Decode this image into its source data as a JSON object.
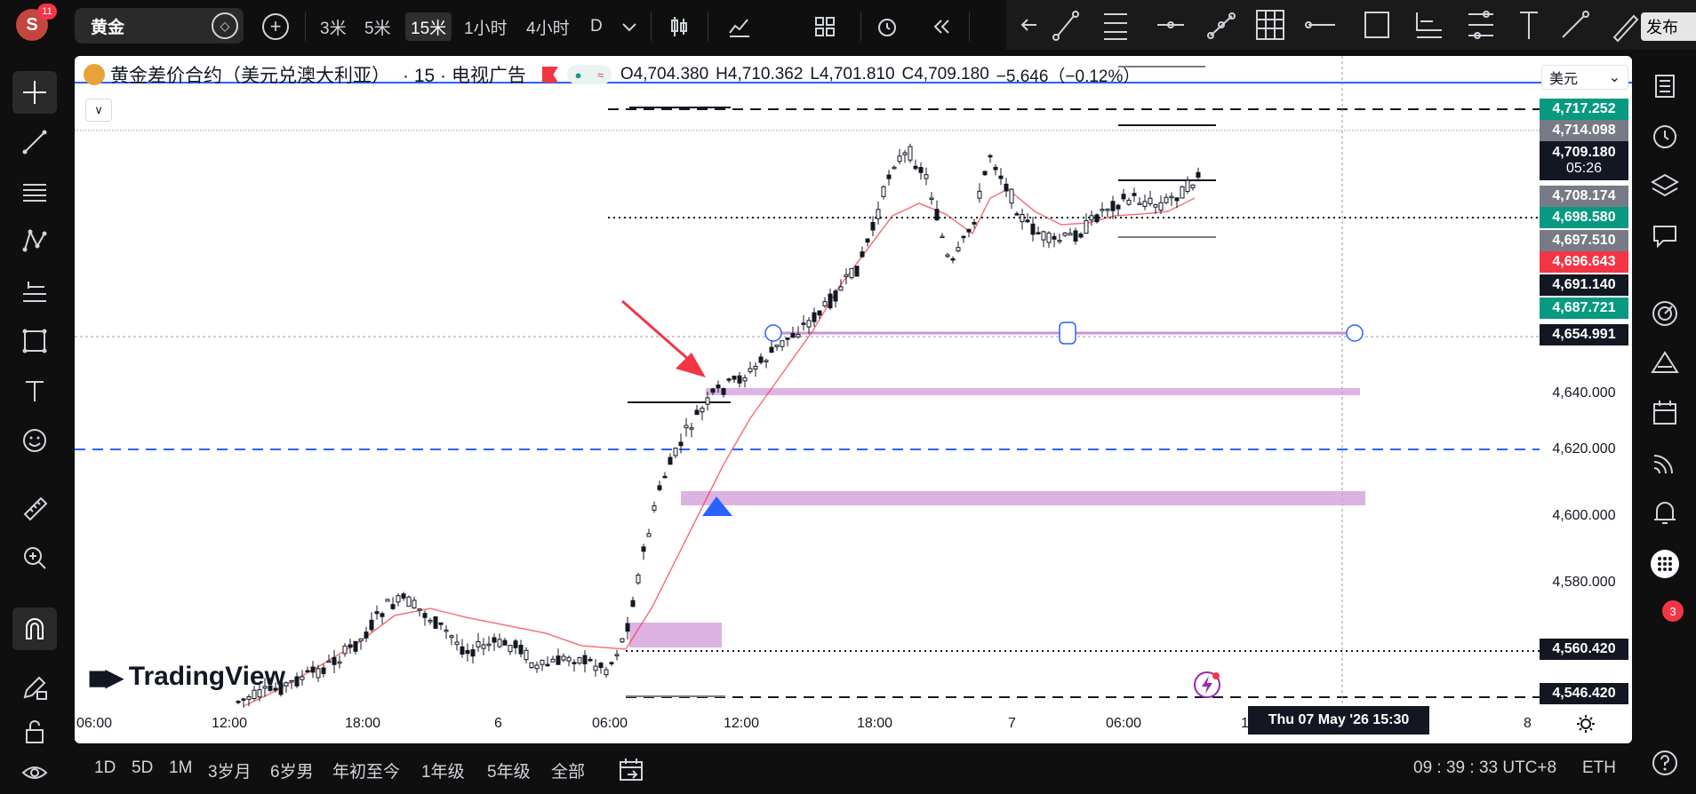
{
  "topbar": {
    "avatar_letter": "S",
    "avatar_badge": "11",
    "symbol": "黄金",
    "timeframes": [
      {
        "label": "3米",
        "active": false
      },
      {
        "label": "5米",
        "active": false
      },
      {
        "label": "15米",
        "active": true
      },
      {
        "label": "1小时",
        "active": false
      },
      {
        "label": "4小时",
        "active": false
      },
      {
        "label": "D",
        "active": false
      }
    ],
    "publish_label": "发布"
  },
  "legend": {
    "title": "黄金差价合约（美元兑澳大利亚）",
    "interval": "· 15 · 电视广告",
    "open": "O4,704.380",
    "high": "H4,710.362",
    "low": "L4,701.810",
    "close": "C4,709.180",
    "change": "−5.646（−0.12%）"
  },
  "currency": "美元",
  "price_axis": {
    "labels": [
      {
        "text": "4,717.252",
        "color": "#089981"
      },
      {
        "text": "4,714.098",
        "color": "#787b86"
      },
      {
        "text": "4,709.180",
        "sub": "05:26",
        "color": "#131722"
      },
      {
        "text": "4,708.174",
        "color": "#787b86"
      },
      {
        "text": "4,698.580",
        "color": "#089981"
      },
      {
        "text": "4,697.510",
        "color": "#787b86"
      },
      {
        "text": "4,696.643",
        "color": "#f23645"
      },
      {
        "text": "4,691.140",
        "color": "#131722"
      },
      {
        "text": "4,687.721",
        "color": "#089981"
      },
      {
        "text": "4,654.991",
        "color": "#131722"
      },
      {
        "text": "4,640.000",
        "color": "plain"
      },
      {
        "text": "4,620.000",
        "color": "plain"
      },
      {
        "text": "4,600.000",
        "color": "plain"
      },
      {
        "text": "4,580.000",
        "color": "plain"
      },
      {
        "text": "4,560.420",
        "color": "#131722"
      },
      {
        "text": "4,546.420",
        "color": "#131722"
      }
    ]
  },
  "time_axis": [
    "06:00",
    "12:00",
    "18:00",
    "6",
    "06:00",
    "12:00",
    "18:00",
    "7",
    "06:00",
    "1",
    "8"
  ],
  "crosshair_time": "Thu 07 May '26   15:30",
  "watermark": "TradingView",
  "bottombar": {
    "ranges": [
      "1D",
      "5D",
      "1M",
      "3岁月",
      "6岁男",
      "年初至今",
      "1年级",
      "5年级",
      "全部"
    ],
    "clock": "09 : 39 : 33 UTC+8",
    "session": "ETH"
  },
  "right_badge": "3",
  "icons": {
    "top": [
      "candles-icon",
      "indicators-icon",
      "templates-icon",
      "alert-icon",
      "replay-icon",
      "undo-icon"
    ],
    "left": [
      "crosshair-icon",
      "trendline-icon",
      "fib-icon",
      "pattern-icon",
      "forecast-icon",
      "shapes-icon",
      "text-icon",
      "emoji-icon",
      "ruler-icon",
      "zoom-icon",
      "magnet-icon",
      "pencil-lock-icon",
      "lock-icon",
      "eye-icon"
    ],
    "right": [
      "watchlist-icon",
      "clock-icon",
      "layers-icon",
      "chat-icon",
      "target-icon",
      "triangle-icon",
      "calendar-icon",
      "broadcast-icon",
      "bell-icon",
      "dots-icon",
      "help-icon"
    ]
  }
}
